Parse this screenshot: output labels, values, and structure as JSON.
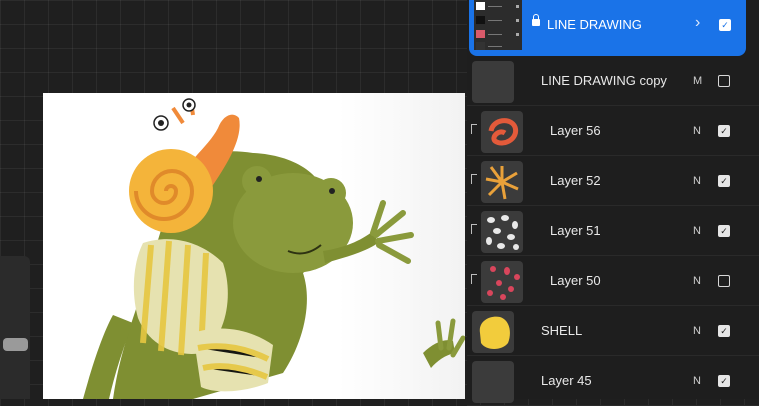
{
  "layers": {
    "active": {
      "name": "LINE DRAWING",
      "visible": true,
      "locked": true
    },
    "items": [
      {
        "name": "LINE DRAWING copy",
        "blend": "M",
        "visible": false,
        "clipped": false,
        "thumb": "empty"
      },
      {
        "name": "Layer 56",
        "blend": "N",
        "visible": true,
        "clipped": true,
        "thumb": "red-swirl"
      },
      {
        "name": "Layer 52",
        "blend": "N",
        "visible": true,
        "clipped": true,
        "thumb": "orange-spiral"
      },
      {
        "name": "Layer 51",
        "blend": "N",
        "visible": true,
        "clipped": true,
        "thumb": "white-spots"
      },
      {
        "name": "Layer 50",
        "blend": "N",
        "visible": false,
        "clipped": true,
        "thumb": "pink-spots"
      },
      {
        "name": "SHELL",
        "blend": "N",
        "visible": true,
        "clipped": false,
        "thumb": "yellow-blob"
      },
      {
        "name": "Layer 45",
        "blend": "N",
        "visible": true,
        "clipped": false,
        "thumb": "empty"
      }
    ]
  },
  "colors": {
    "accent": "#1a73e8",
    "frog": "#8a9a3c",
    "shell": "#f4b43a",
    "snail": "#f08a3a"
  }
}
